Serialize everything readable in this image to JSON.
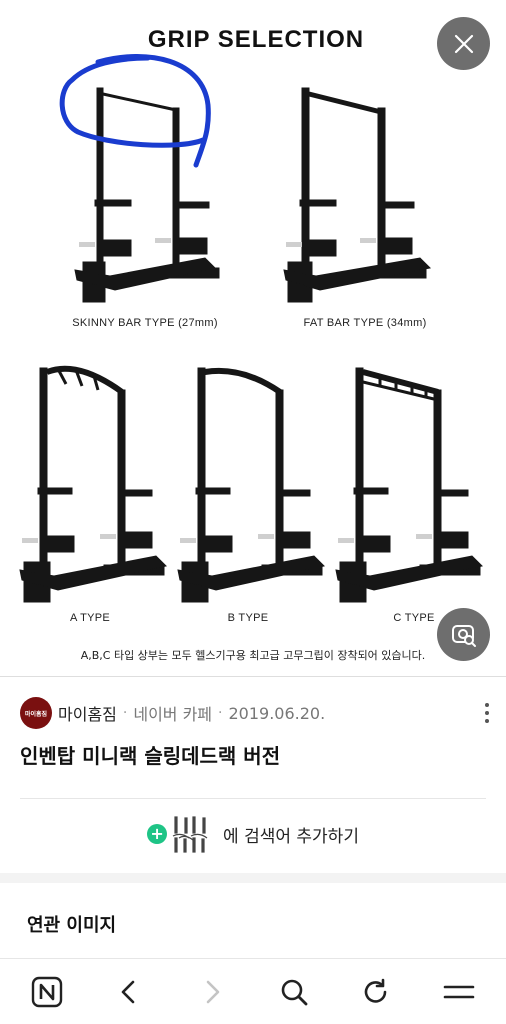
{
  "viewer": {
    "heading": "GRIP SELECTION",
    "captions": {
      "skinny": "SKINNY BAR TYPE (27mm)",
      "fat": "FAT BAR TYPE (34mm)",
      "a": "A TYPE",
      "b": "B TYPE",
      "c": "C TYPE"
    },
    "note": "A,B,C 타입 상부는 모두 헬스기구용 최고급 고무그립이 장착되어 있습니다."
  },
  "source": {
    "avatar_text": "마이홈짐",
    "name": "마이홈짐",
    "platform": "네이버 카페",
    "date": "2019.06.20.",
    "separator": "·"
  },
  "post": {
    "title": "인벤탑 미니랙 슬링데드랙 버전"
  },
  "add_search": {
    "label": "에 검색어 추가하기",
    "plus": "+"
  },
  "related": {
    "heading": "연관 이미지"
  },
  "icons": {
    "close": "close-icon",
    "lens": "image-search-icon",
    "more": "more-vertical-icon",
    "home": "naver-n-icon",
    "back": "chevron-left-icon",
    "forward": "chevron-right-icon",
    "search": "search-icon",
    "refresh": "refresh-icon",
    "menu": "menu-icon"
  },
  "colors": {
    "annotation": "#1a3ccf",
    "accent_green": "#1ec486",
    "overlay_button": "#6e6e6e"
  }
}
